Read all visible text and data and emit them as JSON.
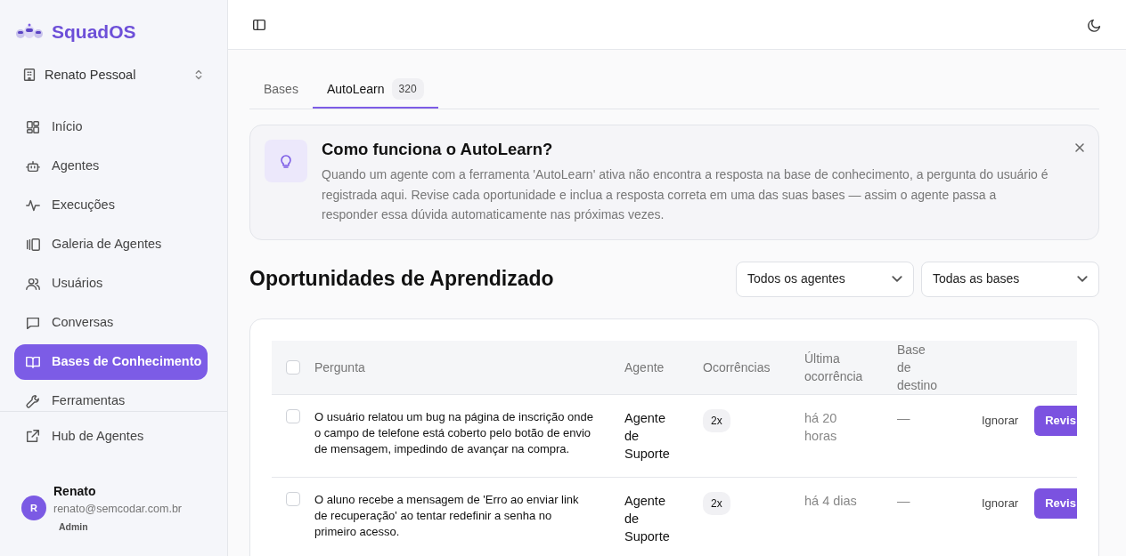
{
  "brand": "SquadOS",
  "workspace": "Renato Pessoal",
  "nav": [
    {
      "label": "Início",
      "selected": false
    },
    {
      "label": "Agentes",
      "selected": false
    },
    {
      "label": "Execuções",
      "selected": false
    },
    {
      "label": "Galeria de Agentes",
      "selected": false
    },
    {
      "label": "Usuários",
      "selected": false
    },
    {
      "label": "Conversas",
      "selected": false
    },
    {
      "label": "Bases de Conhecimento",
      "selected": true
    },
    {
      "label": "Ferramentas",
      "selected": false
    }
  ],
  "hub_link": "Hub de Agentes",
  "user": {
    "initial": "R",
    "name": "Renato",
    "email": "renato@semcodar.com.br",
    "role": "Admin"
  },
  "tabs": [
    {
      "label": "Bases",
      "selected": false
    },
    {
      "label": "AutoLearn",
      "count": "320",
      "selected": true
    }
  ],
  "info": {
    "title": "Como funciona o AutoLearn?",
    "text": "Quando um agente com a ferramenta 'AutoLearn' ativa não encontra a resposta na base de conhecimento, a pergunta do usuário é registrada aqui. Revise cada oportunidade e inclua a resposta correta em uma das suas bases — assim o agente passa a responder essa dúvida automaticamente nas próximas vezes."
  },
  "section_title": "Oportunidades de Aprendizado",
  "filters": [
    "Todos os agentes",
    "Todas as bases"
  ],
  "table": {
    "all_checked": false,
    "columns": [
      "Pergunta",
      "Agente",
      "Ocorrências",
      "Última ocorrência",
      "Base de destino"
    ],
    "rows": [
      {
        "checked": false,
        "question": "O usuário relatou um bug na página de inscrição onde o campo de telefone está coberto pelo botão de envio de mensagem, impedindo de avançar na compra.",
        "agent": "Agente de Suporte",
        "occurrences": "2x",
        "last": "há 20 horas",
        "base": "—",
        "ignore": "Ignorar",
        "review": "Revis"
      },
      {
        "checked": false,
        "question": "O aluno recebe a mensagem de 'Erro ao enviar link de recuperação' ao tentar redefinir a senha no primeiro acesso.",
        "agent": "Agente de Suporte",
        "occurrences": "2x",
        "last": "há 4 dias",
        "base": "—",
        "ignore": "Ignorar",
        "review": "Revis"
      }
    ]
  }
}
